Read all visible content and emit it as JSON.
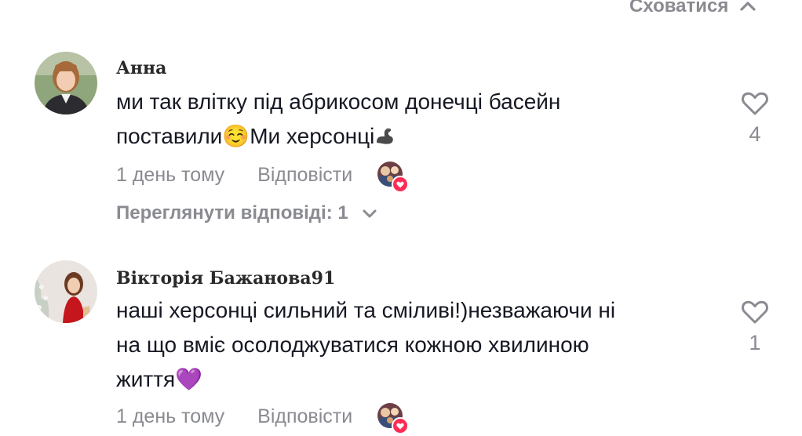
{
  "header": {
    "hide_label": "Сховатися",
    "hide_icon": "chevron-up-icon"
  },
  "comments": [
    {
      "username": "Анна",
      "text_part1": "ми так влітку під абрикосом донечці басейн",
      "text_part2": "поставили",
      "emoji_smile": "☺️",
      "text_part3": "Ми херсонці",
      "emoji_flex": "flexed-biceps-icon",
      "time": "1 день тому",
      "reply_label": "Відповісти",
      "like_count": "4",
      "view_replies_label": "Переглянути відповіді: 1"
    },
    {
      "username": "Вікторія Бажанова91",
      "text_line1": "наші херсонці сильний та сміливі!)незважаючи ні",
      "text_line2": "на що вміє осолоджуватися кожною хвилиною",
      "text_line3": "життя",
      "emoji_heart": "💜",
      "time": "1 день тому",
      "reply_label": "Відповісти",
      "like_count": "1"
    }
  ],
  "colors": {
    "muted": "#8a8b91",
    "text": "#161823",
    "badge": "#fe2c55"
  }
}
